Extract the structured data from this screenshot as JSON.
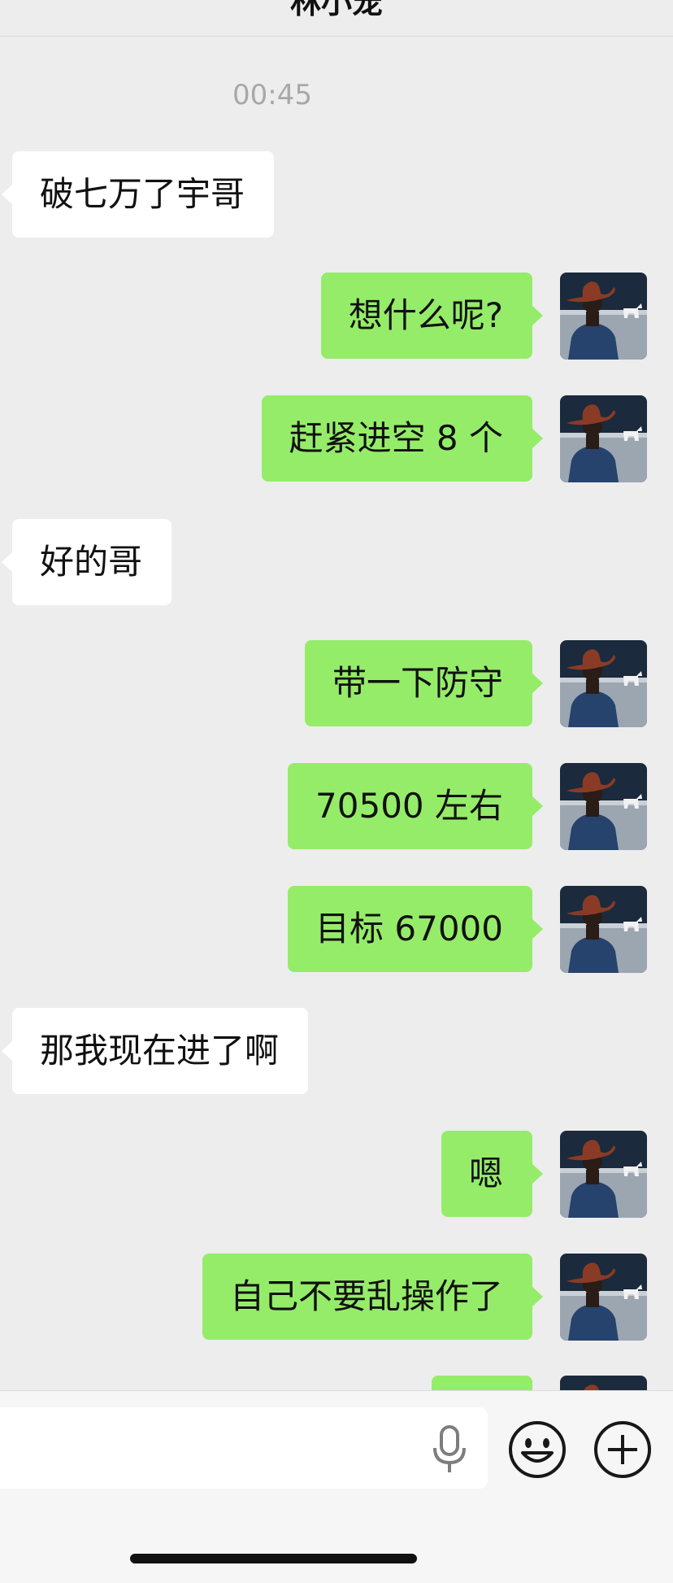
{
  "header": {
    "title": "林小宠"
  },
  "chat": {
    "timestamp": "00:45",
    "messages": [
      {
        "side": "in",
        "text": "破七万了宇哥"
      },
      {
        "side": "out",
        "text": "想什么呢?"
      },
      {
        "side": "out",
        "text": "赶紧进空 8 个"
      },
      {
        "side": "in",
        "text": "好的哥"
      },
      {
        "side": "out",
        "text": "带一下防守"
      },
      {
        "side": "out",
        "text": "70500 左右"
      },
      {
        "side": "out",
        "text": "目标 67000"
      },
      {
        "side": "in",
        "text": "那我现在进了啊"
      },
      {
        "side": "out",
        "text": "嗯"
      },
      {
        "side": "out",
        "text": "自己不要乱操作了"
      },
      {
        "side": "out",
        "text": ""
      }
    ]
  },
  "input_bar": {
    "placeholder": "",
    "icons": [
      "microphone-icon",
      "emoji-icon",
      "plus-icon"
    ]
  },
  "colors": {
    "background": "#ededed",
    "outgoing_bubble": "#95ec69",
    "incoming_bubble": "#ffffff",
    "timestamp": "#a8a8a8"
  }
}
